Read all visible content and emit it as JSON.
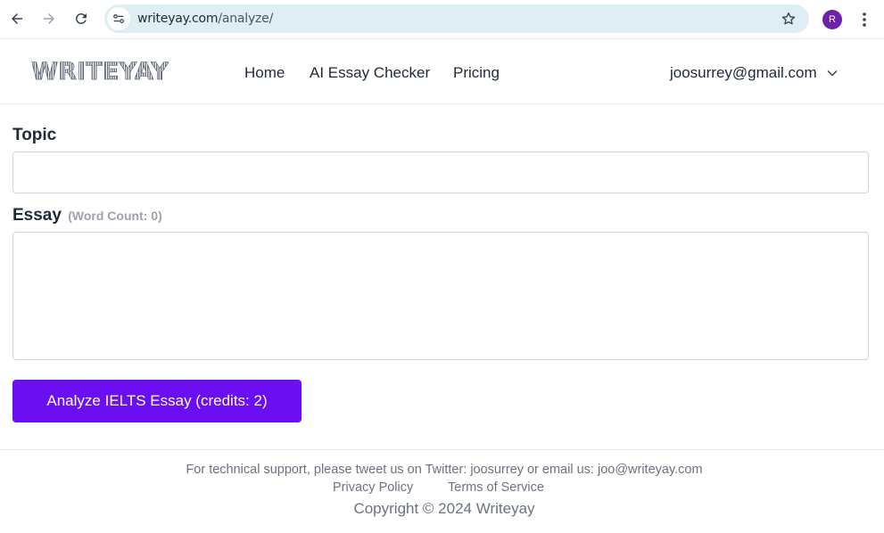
{
  "browser": {
    "url_domain": "writeyay.com",
    "url_path": "/analyze/",
    "profile_initial": "R"
  },
  "site": {
    "logo_text": "WRITEYAY",
    "nav": {
      "home": "Home",
      "checker": "AI Essay Checker",
      "pricing": "Pricing"
    },
    "account_email": "joosurrey@gmail.com"
  },
  "form": {
    "topic_label": "Topic",
    "topic_value": "",
    "essay_label": "Essay",
    "word_count": "(Word Count: 0)",
    "essay_value": "",
    "analyze_button": "Analyze IELTS Essay (credits: 2)"
  },
  "footer": {
    "support": "For technical support, please tweet us on Twitter: joosurrey or email us: joo@writeyay.com",
    "privacy": "Privacy Policy",
    "terms": "Terms of Service",
    "copyright": "Copyright © 2024 Writeyay"
  },
  "colors": {
    "accent": "#6b0ff2",
    "omnibox": "#deeef2",
    "profile": "#6b21a8"
  },
  "icons": [
    "back-arrow-icon",
    "forward-arrow-icon",
    "reload-icon",
    "site-info-icon",
    "star-icon",
    "kebab-menu-icon",
    "chevron-down-icon"
  ]
}
